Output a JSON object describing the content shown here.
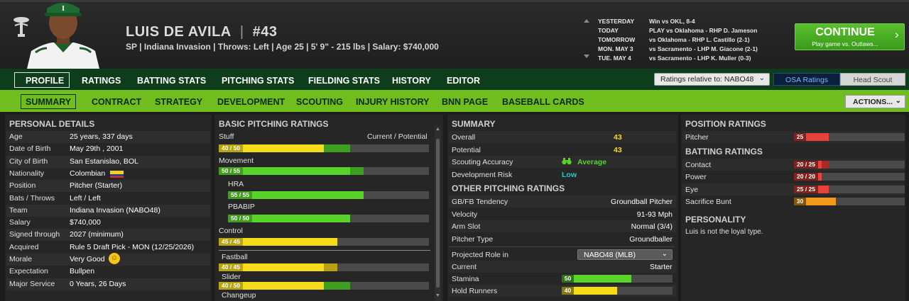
{
  "player": {
    "name": "LUIS DE AVILA",
    "number": "#43",
    "info": "SP | Indiana Invasion  |  Throws: Left  |  Age 25  |  5' 9\" - 215 lbs  |  Salary: $740,000"
  },
  "schedule": [
    {
      "label": "YESTERDAY",
      "value": "Win vs OKL, 8-4"
    },
    {
      "label": "TODAY",
      "value": "PLAY vs Oklahoma - RHP D. Jameson"
    },
    {
      "label": "TOMORROW",
      "value": "vs Oklahoma - RHP L. Castillo (2-1)"
    },
    {
      "label": "MON. MAY 3",
      "value": "vs Sacramento - LHP M. Giacone (2-1)"
    },
    {
      "label": "TUE. MAY 4",
      "value": "vs Sacramento - LHP K. Muller (0-3)"
    }
  ],
  "continue": {
    "label": "CONTINUE",
    "sub": "Play game vs. Outlaws..."
  },
  "nav1": {
    "items": [
      "PROFILE",
      "RATINGS",
      "BATTING STATS",
      "PITCHING STATS",
      "FIELDING STATS",
      "HISTORY",
      "EDITOR"
    ],
    "ratings_relative": "Ratings relative to: NABO48",
    "osa": "OSA Ratings",
    "head_scout": "Head Scout"
  },
  "nav2": {
    "items": [
      "SUMMARY",
      "CONTRACT",
      "STRATEGY",
      "DEVELOPMENT",
      "SCOUTING",
      "INJURY HISTORY",
      "BNN PAGE",
      "BASEBALL CARDS"
    ],
    "actions": "ACTIONS..."
  },
  "personal": {
    "title": "PERSONAL DETAILS",
    "rows": [
      {
        "label": "Age",
        "value": "25 years, 337 days"
      },
      {
        "label": "Date of Birth",
        "value": "May 29th , 2001"
      },
      {
        "label": "City of Birth",
        "value": "San Estanislao, BOL"
      },
      {
        "label": "Nationality",
        "value": "Colombian"
      },
      {
        "label": "Position",
        "value": "Pitcher (Starter)"
      },
      {
        "label": "Bats / Throws",
        "value": "Left / Left"
      },
      {
        "label": "Team",
        "value": "Indiana Invasion (NABO48)"
      },
      {
        "label": "Salary",
        "value": "$740,000"
      },
      {
        "label": "Signed through",
        "value": "2027 (minimum)"
      },
      {
        "label": "Acquired",
        "value": "Rule 5 Draft Pick - MON (12/25/2026)"
      },
      {
        "label": "Morale",
        "value": "Very Good"
      },
      {
        "label": "Expectation",
        "value": "Bullpen"
      },
      {
        "label": "Major Service",
        "value": "0 Years, 26 Days"
      }
    ]
  },
  "pitching": {
    "title": "BASIC PITCHING RATINGS",
    "subtitle": "Current / Potential",
    "ratings": [
      {
        "label": "Stuff",
        "text": "40 / 50",
        "current": 40,
        "potential": 50,
        "color": "#f5dc1a"
      },
      {
        "label": "Movement",
        "text": "50 / 55",
        "current": 50,
        "potential": 55,
        "color": "#58d32a"
      },
      {
        "label": "HRA",
        "text": "55 / 55",
        "current": 55,
        "potential": 55,
        "color": "#58d32a"
      },
      {
        "label": "PBABIP",
        "text": "50 / 50",
        "current": 50,
        "potential": 50,
        "color": "#58d32a"
      },
      {
        "label": "Control",
        "text": "45 / 45",
        "current": 45,
        "potential": 45,
        "color": "#f5dc1a"
      },
      {
        "label": "Fastball",
        "text": "40 / 45",
        "current": 40,
        "potential": 45,
        "color": "#f5dc1a"
      },
      {
        "label": "Slider",
        "text": "40 / 50",
        "current": 40,
        "potential": 50,
        "color": "#f5dc1a"
      },
      {
        "label": "Changeup",
        "text": "",
        "current": 0,
        "potential": 0,
        "color": "#f5dc1a"
      }
    ]
  },
  "summary": {
    "title": "SUMMARY",
    "overall_label": "Overall",
    "overall": "43",
    "potential_label": "Potential",
    "potential": "43",
    "scouting_label": "Scouting Accuracy",
    "scouting": "Average",
    "devrisk_label": "Development Risk",
    "devrisk": "Low"
  },
  "other": {
    "title": "OTHER PITCHING RATINGS",
    "rows": [
      {
        "label": "GB/FB Tendency",
        "value": "Groundball Pitcher"
      },
      {
        "label": "Velocity",
        "value": "91-93 Mph"
      },
      {
        "label": "Arm Slot",
        "value": "Normal (3/4)"
      },
      {
        "label": "Pitcher Type",
        "value": "Groundballer"
      }
    ],
    "role_label": "Projected Role in",
    "role_select": "NABO48 (MLB)",
    "current_label": "Current",
    "current_value": "Starter",
    "stamina": {
      "label": "Stamina",
      "value": 50,
      "text": "50",
      "color": "#58d32a"
    },
    "hold": {
      "label": "Hold Runners",
      "value": 40,
      "text": "40",
      "color": "#f5dc1a"
    }
  },
  "position": {
    "title": "POSITION RATINGS",
    "pitcher": {
      "label": "Pitcher",
      "value": 25,
      "text": "25",
      "color": "#e8403a"
    }
  },
  "batting": {
    "title": "BATTING RATINGS",
    "rows": [
      {
        "label": "Contact",
        "text": "20 / 25",
        "current": 20,
        "potential": 25,
        "color": "#e8403a"
      },
      {
        "label": "Power",
        "text": "20 / 20",
        "current": 20,
        "potential": 20,
        "color": "#e8403a"
      },
      {
        "label": "Eye",
        "text": "25 / 25",
        "current": 25,
        "potential": 25,
        "color": "#e8403a"
      },
      {
        "label": "Sacrifice Bunt",
        "text": "30",
        "current": 30,
        "potential": 30,
        "color": "#f39a1a"
      }
    ]
  },
  "personality": {
    "title": "PERSONALITY",
    "text": "Luis is not the loyal type."
  }
}
